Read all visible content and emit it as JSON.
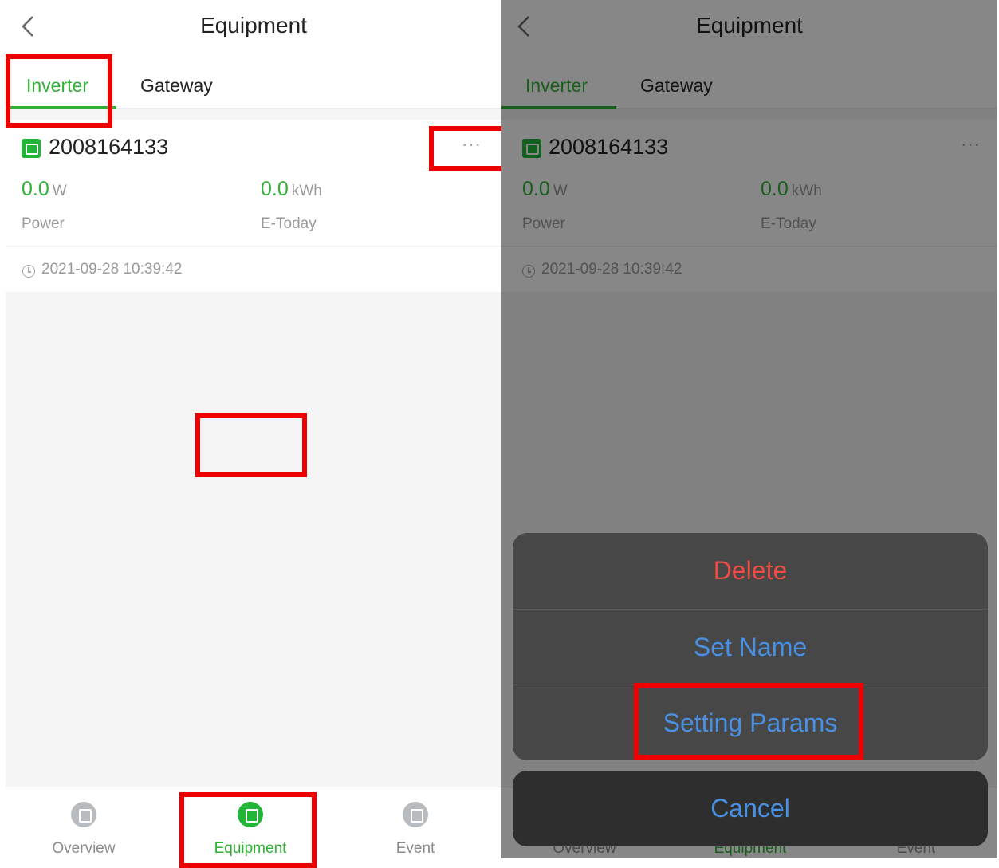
{
  "header": {
    "title": "Equipment"
  },
  "tabs": [
    {
      "label": "Inverter",
      "active": true
    },
    {
      "label": "Gateway",
      "active": false
    }
  ],
  "device": {
    "name": "2008164133",
    "more": "···",
    "power": {
      "value": "0.0",
      "unit": "W",
      "label": "Power"
    },
    "today": {
      "value": "0.0",
      "unit": "kWh",
      "label": "E-Today"
    },
    "timestamp": "2021-09-28 10:39:42"
  },
  "bottom_nav": [
    {
      "label": "Overview",
      "icon": "overview-icon",
      "active": false
    },
    {
      "label": "Equipment",
      "icon": "equipment-icon",
      "active": true
    },
    {
      "label": "Event",
      "icon": "event-icon",
      "active": false
    }
  ],
  "action_sheet": {
    "items": [
      "Delete",
      "Set Name",
      "Setting Params"
    ],
    "cancel": "Cancel"
  },
  "colors": {
    "accent_green": "#2fb135",
    "delete_red": "#ef4a44",
    "action_blue": "#4a90e2",
    "highlight_red": "#ee0000"
  }
}
